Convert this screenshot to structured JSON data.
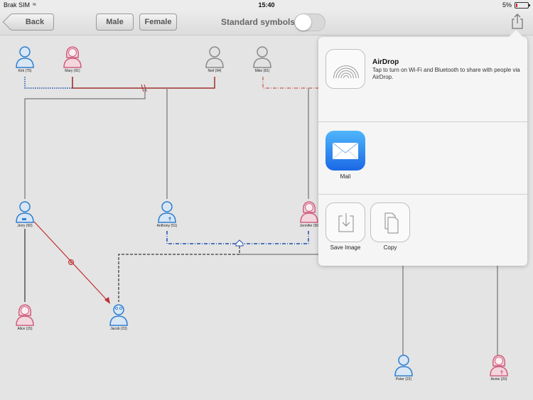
{
  "status_bar": {
    "carrier": "Brak SIM",
    "time": "15:40",
    "battery": "5%"
  },
  "toolbar": {
    "back_label": "Back",
    "male_label": "Male",
    "female_label": "Female",
    "standard_symbols_label": "Standard symbols:",
    "standard_symbols_on": false
  },
  "people": {
    "kirk": "Kirk (75)",
    "mary": "Mary (91)",
    "neil": "Neil (94)",
    "mike": "Mike (81)",
    "jerry": "Jerry (50)",
    "anthony": "Anthony (51)",
    "jennifer": "Jennifer (50",
    "alice": "Alice (15)",
    "jacob": "Jacob (23)",
    "peter": "Peter (22)",
    "annie": "Annie (20)"
  },
  "colors": {
    "male": "#2f7fd0",
    "female": "#cf5f7f",
    "unknown": "#8a8a8a",
    "marriage_line": "#a03030",
    "blue_line": "#2050b0"
  },
  "share_sheet": {
    "airdrop_title": "AirDrop",
    "airdrop_desc": "Tap to turn on Wi-Fi and Bluetooth to share with people via AirDrop.",
    "mail_label": "Mail",
    "save_image_label": "Save Image",
    "copy_label": "Copy"
  }
}
